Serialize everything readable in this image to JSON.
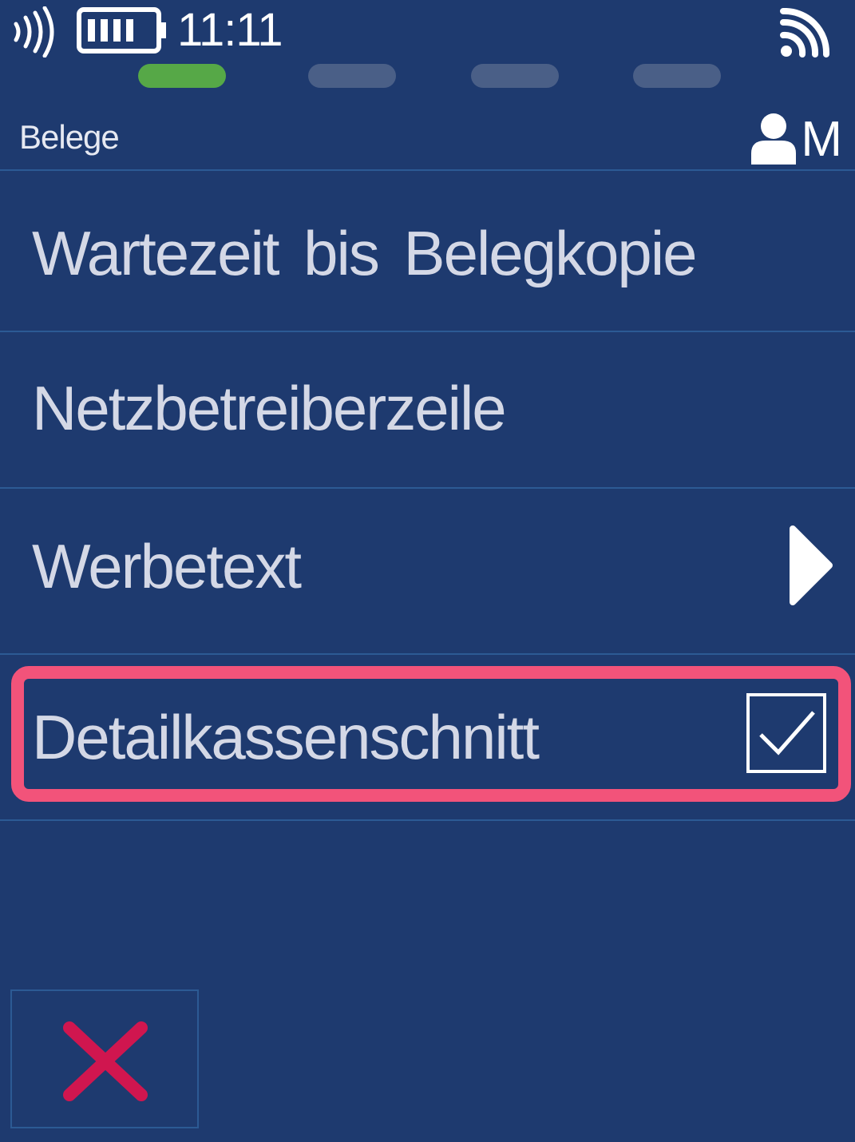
{
  "status_bar": {
    "time": "11:11",
    "icons": [
      "nfc-icon",
      "battery-icon",
      "wifi-icon"
    ]
  },
  "steps": {
    "total": 4,
    "active_index": 0,
    "active_color": "#56a847",
    "inactive_color": "#4a5f87"
  },
  "header": {
    "title": "Belege",
    "user_icon": "user-icon",
    "user_letter": "M"
  },
  "menu": {
    "items": [
      {
        "label": "Wartezeit bis Belegkopie"
      },
      {
        "label": "Netzbetreiberzeile"
      },
      {
        "label": "Werbetext",
        "icon": "arrow-right-icon"
      },
      {
        "label": "Detailkassenschnitt",
        "checked": true,
        "highlighted": true,
        "icon": "checkbox-checked-icon"
      }
    ]
  },
  "footer": {
    "cancel_icon": "close-icon",
    "cancel_color": "#d0164f"
  },
  "colors": {
    "background": "#1e3a6f",
    "divider": "#2c5a94",
    "highlight": "#f2537a",
    "text": "#d4d8e6"
  }
}
